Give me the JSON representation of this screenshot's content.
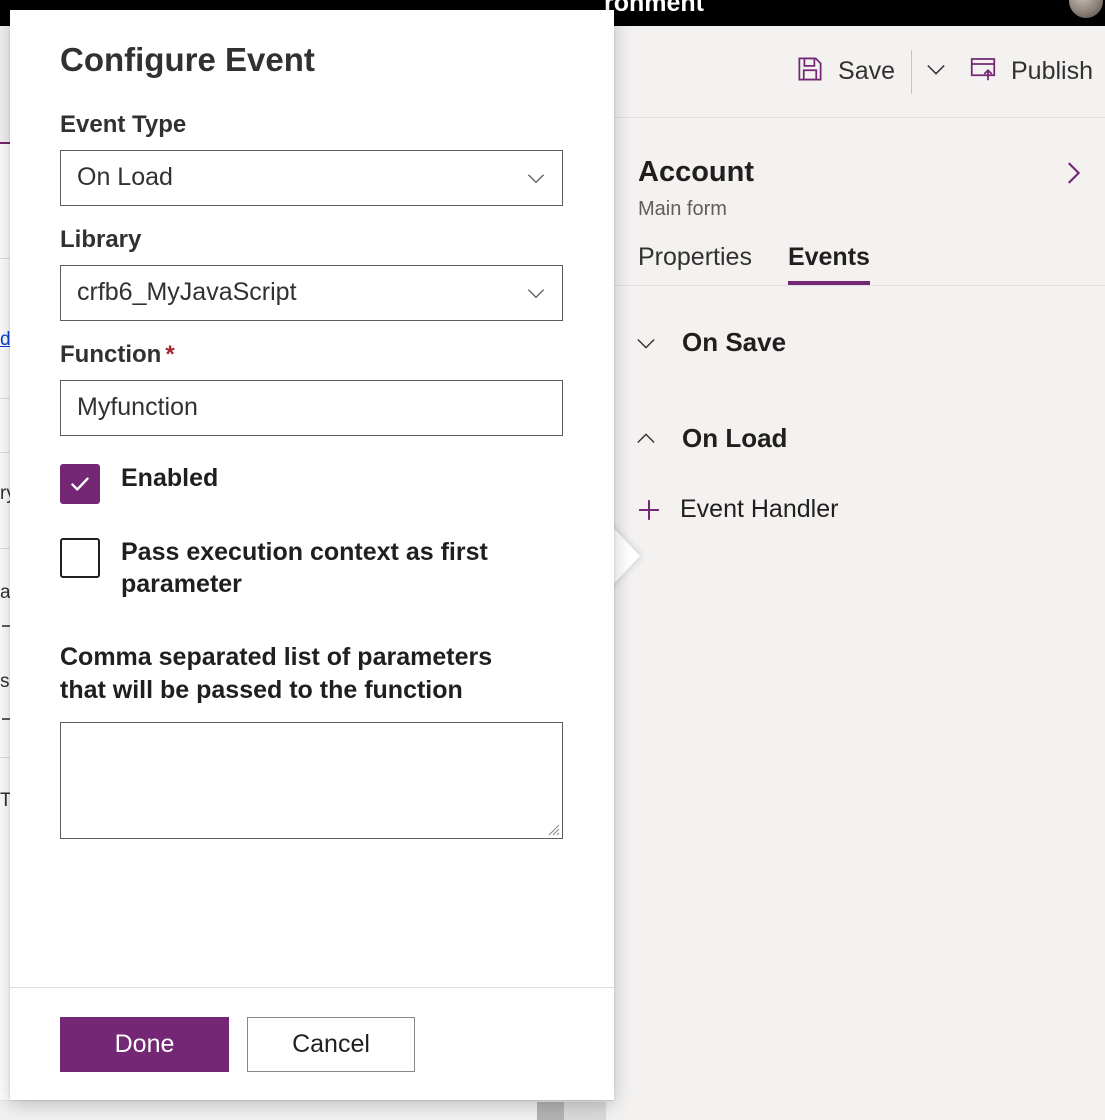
{
  "topbar": {
    "title_fragment": "ronment",
    "avatar": "user-avatar"
  },
  "commandbar": {
    "save_label": "Save",
    "save_icon": "floppy-disk-icon",
    "caret_icon": "chevron-down-icon",
    "publish_label": "Publish",
    "publish_icon": "publish-window-icon"
  },
  "panel": {
    "title": "Account",
    "subtitle": "Main form",
    "expand_icon": "chevron-right-icon",
    "tabs": [
      {
        "label": "Properties",
        "active": false
      },
      {
        "label": "Events",
        "active": true
      }
    ],
    "events": [
      {
        "label": "On Save",
        "expanded": false,
        "chevron": "chevron-down-icon"
      },
      {
        "label": "On Load",
        "expanded": true,
        "chevron": "chevron-up-icon"
      }
    ],
    "add_handler_label": "Event Handler",
    "add_handler_icon": "plus-icon"
  },
  "dialog": {
    "title": "Configure Event",
    "fields": {
      "event_type": {
        "label": "Event Type",
        "value": "On Load",
        "icon": "chevron-down-icon"
      },
      "library": {
        "label": "Library",
        "value": "crfb6_MyJavaScript",
        "icon": "chevron-down-icon"
      },
      "function": {
        "label": "Function",
        "required_marker": "*",
        "value": "Myfunction",
        "placeholder": ""
      }
    },
    "checkboxes": [
      {
        "label": "Enabled",
        "checked": true
      },
      {
        "label": "Pass execution context as first parameter",
        "checked": false
      }
    ],
    "parameters": {
      "label": "Comma separated list of parameters that will be passed to the function",
      "value": "",
      "placeholder": ""
    },
    "buttons": {
      "done_label": "Done",
      "cancel_label": "Cancel"
    }
  },
  "background_list": {
    "link_fragment": "di",
    "fragments": [
      "ry",
      "ai",
      "sin",
      "TS"
    ]
  },
  "colors": {
    "accent_purple": "#742774",
    "required_red": "#a4262c",
    "panel_bg": "#f3f2f1",
    "border_grey": "#605e5c",
    "text_primary": "#201f1e",
    "link_blue": "#0f3fd8"
  }
}
